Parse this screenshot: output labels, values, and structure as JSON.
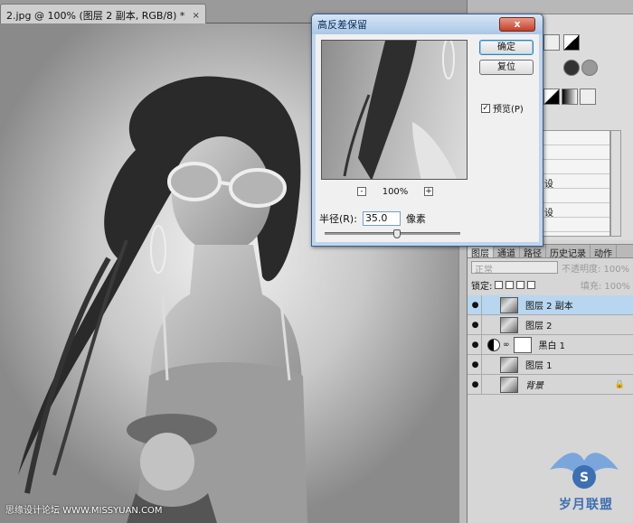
{
  "document": {
    "tab_title": "2.jpg @ 100% (图层 2 副本, RGB/8) *",
    "tab_close": "×"
  },
  "dialog": {
    "title": "高反差保留",
    "close_glyph": "x",
    "ok_label": "确定",
    "reset_label": "复位",
    "preview_label": "预览(P)",
    "preview_checked": "✓",
    "zoom_minus": "-",
    "zoom_plus": "+",
    "zoom_value": "100%",
    "radius_label": "半径(R):",
    "radius_value": "35.0",
    "radius_unit": "像素",
    "radius_slider_fraction": 0.53
  },
  "presets_menu": {
    "items": [
      "",
      "",
      "",
      "设",
      "",
      "设",
      ""
    ]
  },
  "layers_panel": {
    "tabs": [
      "图层",
      "通道",
      "路径",
      "历史记录",
      "动作"
    ],
    "blend_mode": "正常",
    "opacity_label": "不透明度: 100%",
    "lock_label": "锁定:",
    "fill_label": "填充: 100%",
    "layers": [
      {
        "name": "图层 2 副本",
        "type": "pixel",
        "selected": true,
        "italic": false
      },
      {
        "name": "图层 2",
        "type": "pixel",
        "selected": false,
        "italic": false
      },
      {
        "name": "黑白 1",
        "type": "adjustment",
        "selected": false,
        "italic": false
      },
      {
        "name": "图层 1",
        "type": "pixel",
        "selected": false,
        "italic": false
      },
      {
        "name": "背景",
        "type": "pixel",
        "selected": false,
        "italic": true
      }
    ],
    "eye_glyph": "●",
    "lock_glyph": "🔒"
  },
  "watermark": {
    "left_text": "思缘设计论坛 WWW.MISSYUAN.COM",
    "brand_text": "岁月联盟",
    "brand_sub": "S"
  },
  "colors": {
    "dialog_frame": "#bfd5ec",
    "selected_layer": "#b8d6ef",
    "close_button": "#c3402a"
  }
}
